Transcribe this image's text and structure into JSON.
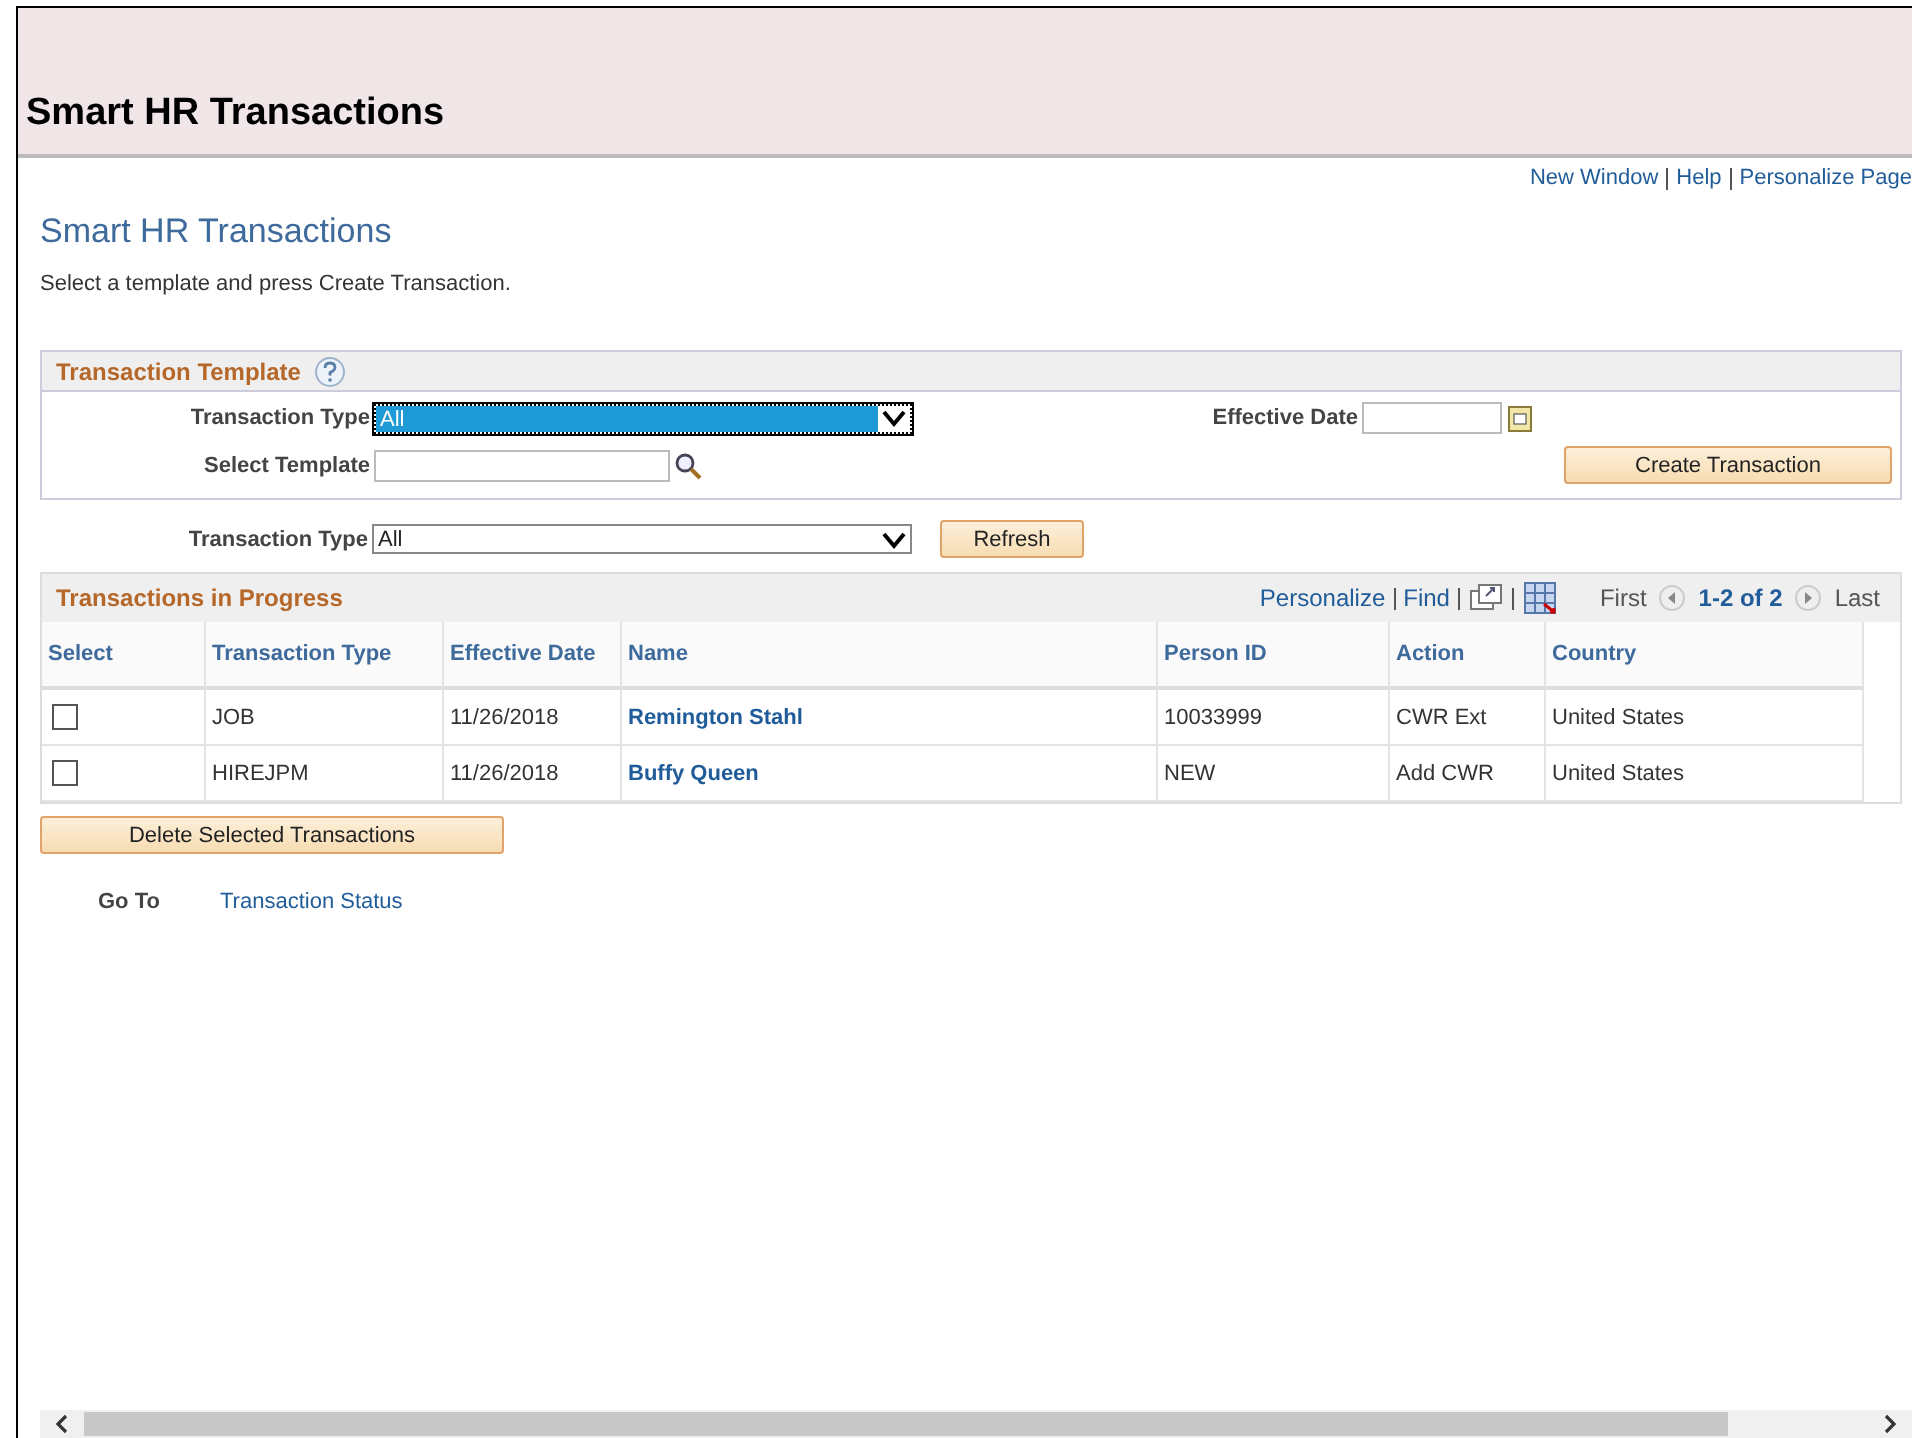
{
  "header": {
    "title": "Smart HR Transactions"
  },
  "top_links": [
    "New Window",
    "Help",
    "Personalize Page"
  ],
  "page_title": "Smart HR Transactions",
  "instructions": "Select a template and press Create Transaction.",
  "template_section": {
    "title": "Transaction Template",
    "transaction_type": {
      "label": "Transaction Type",
      "value": "All",
      "focused": true
    },
    "select_template": {
      "label": "Select Template"
    },
    "effective_date": {
      "label": "Effective Date"
    },
    "create_button": "Create Transaction"
  },
  "filter": {
    "label": "Transaction Type",
    "value": "All",
    "focused": false
  },
  "refresh_button": "Refresh",
  "grid": {
    "title": "Transactions in Progress",
    "links": [
      "Personalize",
      "Find"
    ],
    "nav": {
      "first": "First",
      "range": "1-2 of 2",
      "last": "Last"
    },
    "select_header": "Select",
    "columns": [
      "Transaction Type",
      "Effective Date",
      "Name",
      "Person ID",
      "Action",
      "Country"
    ],
    "rows": [
      {
        "checked": false,
        "cells": [
          "JOB",
          "11/26/2018",
          "Remington Stahl",
          "10033999",
          "CWR Ext",
          "United States"
        ]
      },
      {
        "checked": false,
        "cells": [
          "HIREJPM",
          "11/26/2018",
          "Buffy Queen",
          "NEW",
          "Add CWR",
          "United States"
        ]
      }
    ]
  },
  "delete_button": "Delete Selected Transactions",
  "goto": {
    "label": "Go To",
    "link": "Transaction Status"
  }
}
